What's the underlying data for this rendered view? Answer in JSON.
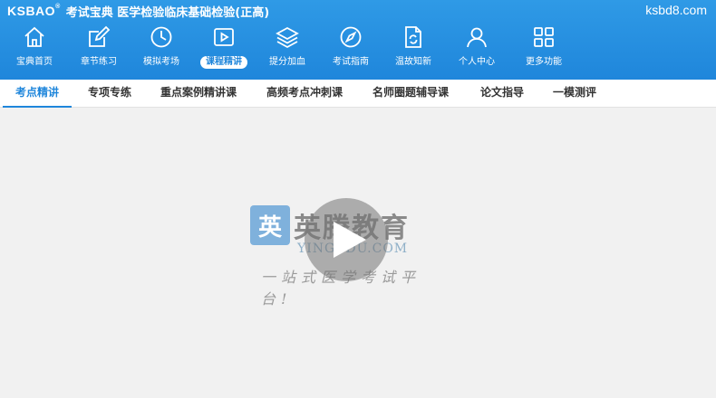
{
  "brand": {
    "logo": "KSBAO",
    "logo_mark": "®",
    "title": "考试宝典  医学检验临床基础检验(正高)"
  },
  "site": "ksbd8.com",
  "nav": [
    {
      "label": "宝典首页",
      "icon": "home-icon"
    },
    {
      "label": "章节练习",
      "icon": "edit-icon"
    },
    {
      "label": "模拟考场",
      "icon": "clock-icon"
    },
    {
      "label": "课程精讲",
      "icon": "video-play-icon",
      "active": true
    },
    {
      "label": "提分加血",
      "icon": "layers-icon"
    },
    {
      "label": "考试指南",
      "icon": "compass-icon"
    },
    {
      "label": "温故知新",
      "icon": "refresh-doc-icon"
    },
    {
      "label": "个人中心",
      "icon": "user-icon"
    },
    {
      "label": "更多功能",
      "icon": "grid-icon"
    }
  ],
  "subnav": [
    {
      "label": "考点精讲",
      "active": true
    },
    {
      "label": "专项专练"
    },
    {
      "label": "重点案例精讲课"
    },
    {
      "label": "高频考点冲刺课"
    },
    {
      "label": "名师圈题辅导课"
    },
    {
      "label": "论文指导"
    },
    {
      "label": "一模测评"
    }
  ],
  "watermark": {
    "badge": "英",
    "name": "英腾教育",
    "domain": "YINGEDU.COM",
    "slogan": "一站式医学考试平台!"
  },
  "colors": {
    "primary": "#1f86db",
    "header_top": "#2f9ae6",
    "background": "#f1f1f1"
  }
}
